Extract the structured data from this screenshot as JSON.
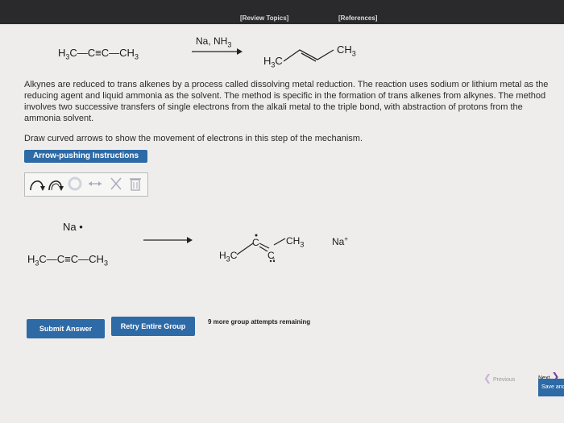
{
  "header": {
    "review_topics": "[Review Topics]",
    "references": "[References]"
  },
  "reaction": {
    "reactant": "H3C—C≡C—CH3",
    "reagent": "Na, NH3",
    "product_left": "H3C",
    "product_right": "CH3"
  },
  "paragraph": "Alkynes are reduced to trans alkenes by a process called dissolving metal reduction. The reaction uses sodium or lithium metal as the reducing agent and liquid ammonia as the solvent. The method is specific in the formation of trans alkenes from alkynes. The method involves two successive transfers of single electrons from the alkali metal to the triple bond, with abstraction of protons from the ammonia solvent.",
  "prompt": "Draw curved arrows to show the movement of electrons in this step of the mechanism.",
  "instructions_button": "Arrow-pushing Instructions",
  "toolbar": {
    "icons": [
      "single-curved-arrow-icon",
      "double-curved-arrow-icon",
      "undo-icon",
      "resonance-arrow-icon",
      "delete-x-icon",
      "trash-icon"
    ]
  },
  "mechanism": {
    "sodium": "Na",
    "alkyne": "H3C—C≡C—CH3",
    "radical_anion_left": "H3C",
    "radical_anion_right": "CH3",
    "carbon_top": "C",
    "carbon_bottom": "C",
    "charge": "-",
    "counterion": "Na"
  },
  "buttons": {
    "submit": "Submit Answer",
    "retry": "Retry Entire Group"
  },
  "attempts": "9 more group attempts remaining",
  "nav": {
    "previous": "Previous",
    "next": "Next"
  },
  "save": "Save and"
}
